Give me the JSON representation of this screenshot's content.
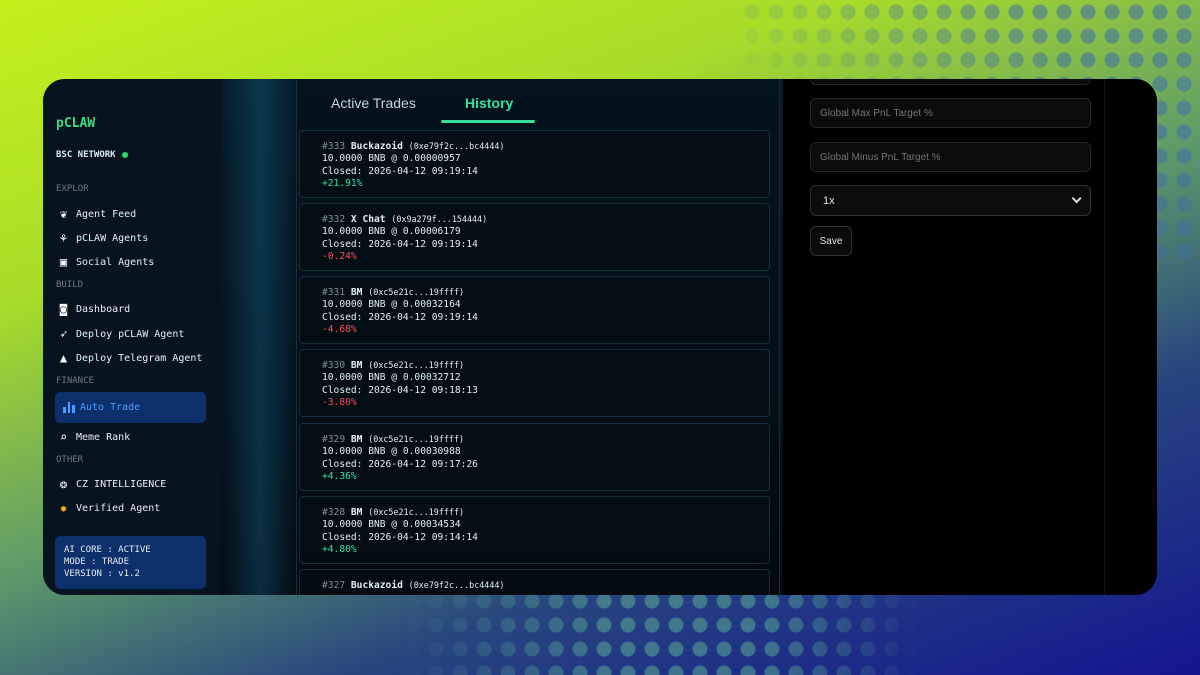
{
  "sidebar": {
    "logo": "pCLAW",
    "network": "BSC NETWORK",
    "sections": {
      "explore": "EXPLOR",
      "build": "BUILD",
      "finance": "FINANCE",
      "other": "OTHER"
    },
    "items": [
      {
        "label": "Agent Feed",
        "icon": "leaf-icon"
      },
      {
        "label": "pCLAW Agents",
        "icon": "sprout-icon"
      },
      {
        "label": "Social Agents",
        "icon": "image-icon"
      },
      {
        "label": "Dashboard",
        "icon": "robot-icon"
      },
      {
        "label": "Deploy pCLAW Agent",
        "icon": "rocket-icon"
      },
      {
        "label": "Deploy Telegram Agent",
        "icon": "wizard-hat-icon"
      },
      {
        "label": "Auto Trade",
        "icon": "bar-chart-icon",
        "active": true
      },
      {
        "label": "Meme Rank",
        "icon": "magnifier-icon"
      },
      {
        "label": "CZ INTELLIGENCE",
        "icon": "brain-icon"
      },
      {
        "label": "Verified Agent",
        "icon": "verified-badge-icon"
      }
    ],
    "status_box": {
      "line1": "AI CORE : ACTIVE",
      "line2": "MODE : TRADE",
      "line3": "VERSION : v1.2"
    }
  },
  "tabs": {
    "active_trades": "Active Trades",
    "history": "History",
    "selected": "History"
  },
  "trades": [
    {
      "id": "#333",
      "name": "Buckazoid",
      "address": "(0xe79f2c...bc4444)",
      "amount": "10.0000 BNB @ 0.00000957",
      "closed": "Closed: 2026-04-12 09:19:14",
      "pnl": "+21.91%"
    },
    {
      "id": "#332",
      "name": "X Chat",
      "address": "(0x9a279f...154444)",
      "amount": "10.0000 BNB @ 0.00006179",
      "closed": "Closed: 2026-04-12 09:19:14",
      "pnl": "-0.24%"
    },
    {
      "id": "#331",
      "name": "BM",
      "address": "(0xc5e21c...19ffff)",
      "amount": "10.0000 BNB @ 0.00032164",
      "closed": "Closed: 2026-04-12 09:19:14",
      "pnl": "-4.68%"
    },
    {
      "id": "#330",
      "name": "BM",
      "address": "(0xc5e21c...19ffff)",
      "amount": "10.0000 BNB @ 0.00032712",
      "closed": "Closed: 2026-04-12 09:18:13",
      "pnl": "-3.80%"
    },
    {
      "id": "#329",
      "name": "BM",
      "address": "(0xc5e21c...19ffff)",
      "amount": "10.0000 BNB @ 0.00030988",
      "closed": "Closed: 2026-04-12 09:17:26",
      "pnl": "+4.36%"
    },
    {
      "id": "#328",
      "name": "BM",
      "address": "(0xc5e21c...19ffff)",
      "amount": "10.0000 BNB @ 0.00034534",
      "closed": "Closed: 2026-04-12 09:14:14",
      "pnl": "+4.80%"
    },
    {
      "id": "#327",
      "name": "Buckazoid",
      "address": "(0xe79f2c...bc4444)",
      "amount": "",
      "closed": "",
      "pnl": ""
    }
  ],
  "settings": {
    "max_pnl_placeholder": "Global Max PnL Target %",
    "minus_pnl_placeholder": "Global Minus PnL Target %",
    "leverage_value": "1x",
    "save_label": "Save"
  },
  "colors": {
    "positive": "#37e0a0",
    "negative": "#ff4d5a",
    "accent": "#3ddc84",
    "active_nav": "#0d2f6b"
  }
}
